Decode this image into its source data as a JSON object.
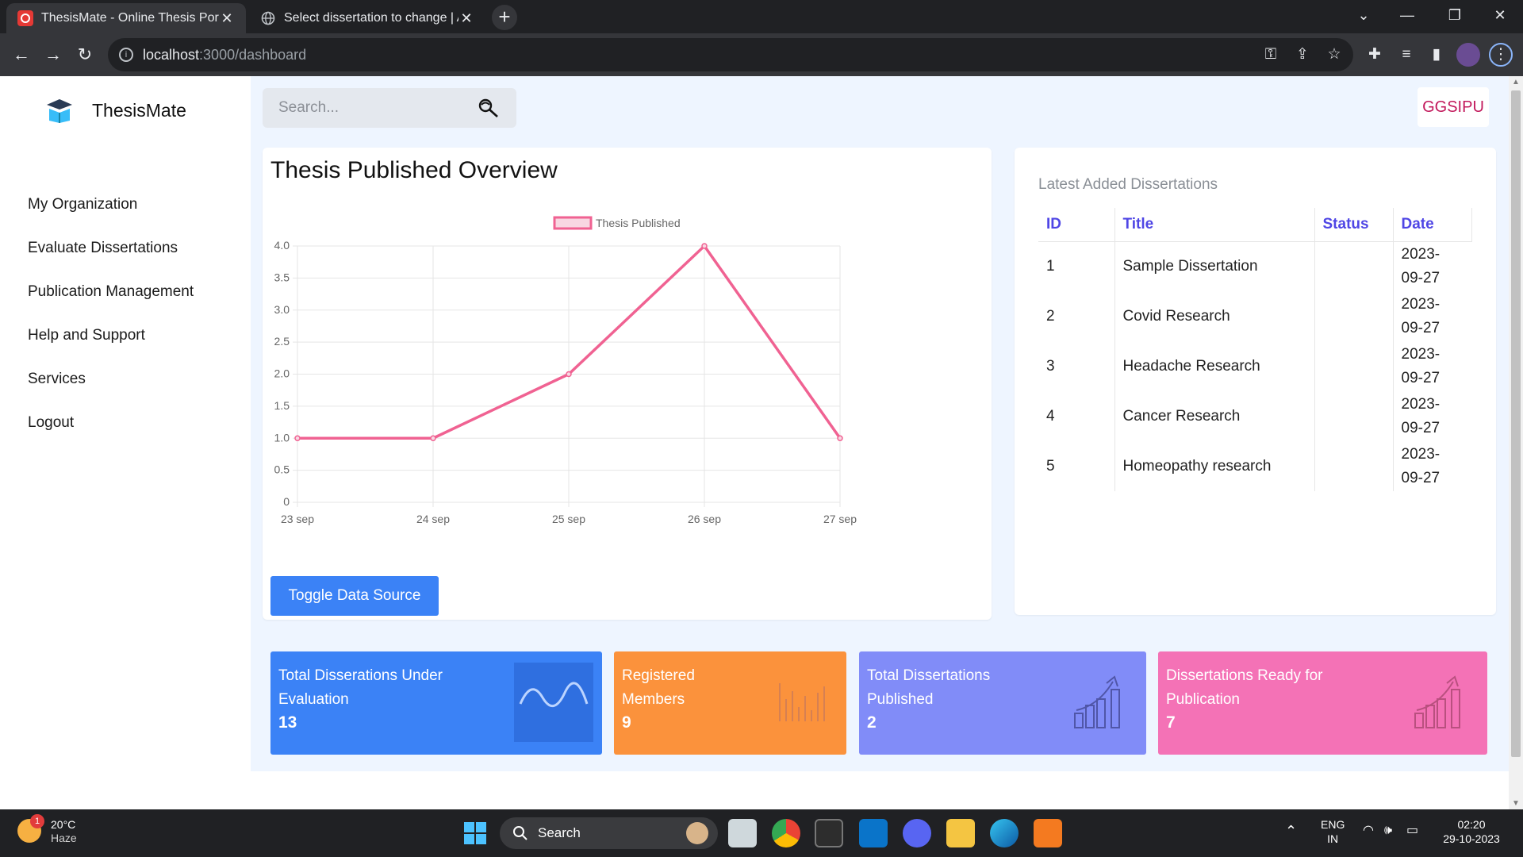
{
  "browser": {
    "tabs": [
      {
        "title": "ThesisMate - Online Thesis Portal",
        "active": true
      },
      {
        "title": "Select dissertation to change | Admin",
        "active": false
      }
    ],
    "url_host": "localhost",
    "url_path": ":3000/dashboard"
  },
  "app": {
    "brand": "ThesisMate",
    "nav": [
      "My Organization",
      "Evaluate Dissertations",
      "Publication Management",
      "Help and Support",
      "Services",
      "Logout"
    ],
    "search_placeholder": "Search...",
    "org_badge": "GGSIPU"
  },
  "overview": {
    "title": "Thesis Published Overview",
    "toggle_label": "Toggle Data Source"
  },
  "chart_data": {
    "type": "line",
    "title": "",
    "xlabel": "",
    "ylabel": "",
    "categories": [
      "23 sep",
      "24 sep",
      "25 sep",
      "26 sep",
      "27 sep"
    ],
    "series": [
      {
        "name": "Thesis Published",
        "values": [
          1,
          1,
          2,
          4,
          1
        ],
        "color": "#f06292"
      }
    ],
    "ylim": [
      0,
      4
    ],
    "yticks": [
      "0",
      "0.5",
      "1.0",
      "1.5",
      "2.0",
      "2.5",
      "3.0",
      "3.5",
      "4.0"
    ],
    "grid": true,
    "legend": "top-center"
  },
  "dissertations": {
    "caption": "Latest Added Dissertations",
    "headers": [
      "ID",
      "Title",
      "Status",
      "Date"
    ],
    "rows": [
      {
        "id": "1",
        "title": "Sample Dissertation",
        "status": "",
        "date_year": "2023-",
        "date_md": "09-27"
      },
      {
        "id": "2",
        "title": "Covid Research",
        "status": "",
        "date_year": "2023-",
        "date_md": "09-27"
      },
      {
        "id": "3",
        "title": "Headache Research",
        "status": "",
        "date_year": "2023-",
        "date_md": "09-27"
      },
      {
        "id": "4",
        "title": "Cancer Research",
        "status": "",
        "date_year": "2023-",
        "date_md": "09-27"
      },
      {
        "id": "5",
        "title": "Homeopathy research",
        "status": "",
        "date_year": "2023-",
        "date_md": "09-27"
      }
    ]
  },
  "stats": [
    {
      "line1": "Total Disserations Under",
      "line2": "Evaluation",
      "value": "13",
      "color": "#3b82f6"
    },
    {
      "line1": "Registered",
      "line2": "Members",
      "value": "9",
      "color": "#fb923c"
    },
    {
      "line1": "Total Dissertations",
      "line2": "Published",
      "value": "2",
      "color": "#818cf8"
    },
    {
      "line1": "Dissertations Ready for",
      "line2": "Publication",
      "value": "7",
      "color": "#f472b6"
    }
  ],
  "taskbar": {
    "temp": "20°C",
    "condition": "Haze",
    "notif_count": "1",
    "search_label": "Search",
    "lang": "ENG",
    "region": "IN",
    "time": "02:20",
    "date": "29-10-2023"
  }
}
